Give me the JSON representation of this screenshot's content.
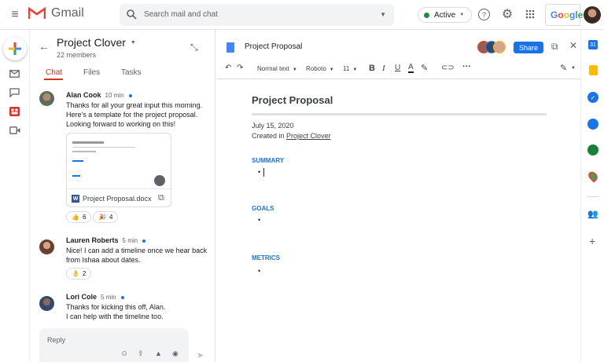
{
  "header": {
    "app_name": "Gmail",
    "search_placeholder": "Search mail and chat",
    "status": "Active",
    "brand": "Google"
  },
  "space": {
    "name": "Project Clover",
    "members": "22 members",
    "tabs": [
      "Chat",
      "Files",
      "Tasks"
    ]
  },
  "messages": [
    {
      "author": "Alan Cook",
      "time": "10 min",
      "lines": [
        "Thanks for all your great input this morning.",
        "Here's a template for the project proposal.",
        "Looking forward to working on this!"
      ],
      "attachment": "Project Proposal.docx",
      "reactions": [
        {
          "emoji": "👍",
          "count": "6"
        },
        {
          "emoji": "🎉",
          "count": "4"
        }
      ]
    },
    {
      "author": "Lauren Roberts",
      "time": "5 min",
      "lines": [
        "Nice! I can add a timeline once we hear back",
        "from Ishaa about dates."
      ],
      "reactions": [
        {
          "emoji": "👌",
          "count": "2"
        }
      ]
    },
    {
      "author": "Lori Cole",
      "time": "5 min",
      "lines": [
        "Thanks for kicking this off, Alan.",
        "I can help with the timeline too."
      ]
    }
  ],
  "reply_placeholder": "Reply",
  "doc": {
    "title": "Project Proposal",
    "share": "Share",
    "style": "Normal text",
    "font": "Roboto",
    "size": "11",
    "heading": "Project Proposal",
    "date": "July 15, 2020",
    "created_prefix": "Created in",
    "created_link": "Project Clover",
    "sections": [
      "SUMMARY",
      "GOALS",
      "METRICS"
    ]
  },
  "colors": {
    "accent": "#1a73e8",
    "active": "#1e8e3e"
  }
}
